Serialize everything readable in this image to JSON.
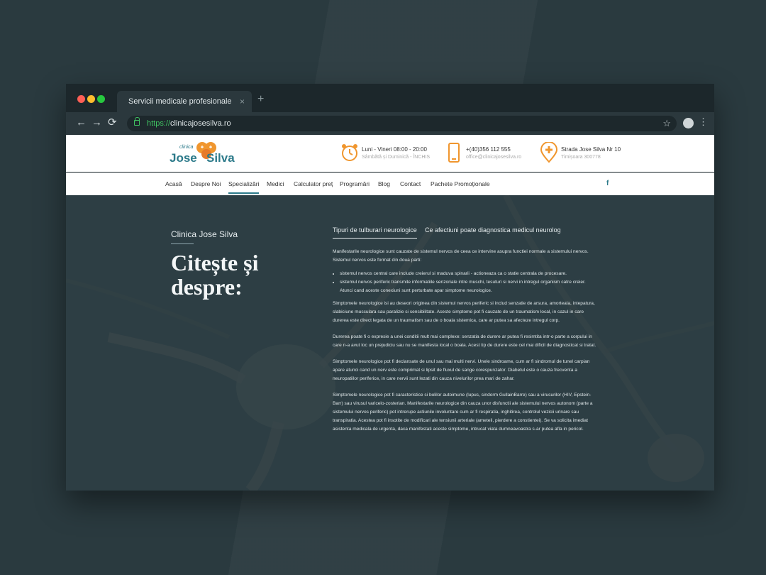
{
  "browser": {
    "tab_title": "Servicii medicale profesionale",
    "tab_close": "×",
    "new_tab": "+",
    "url_scheme": "https://",
    "url_host": "clinicajosesilva.ro",
    "back": "←",
    "forward": "→",
    "reload": "⟳",
    "star": "☆",
    "menu": "⋮"
  },
  "header": {
    "logo": {
      "small": "clinica",
      "word1": "Jose",
      "word2": "Silva"
    },
    "schedule": {
      "main": "Luni - Vineri 08:00 - 20:00",
      "sub": "Sâmbătă și Duminică - ÎNCHIS"
    },
    "contact": {
      "main": "+(40)356 112 555",
      "sub": "office@clinicajosesilva.ro"
    },
    "address": {
      "main": "Strada Jose Silva Nr 10",
      "sub": "Timișoara 300778"
    }
  },
  "nav": {
    "items": [
      "Acasă",
      "Despre Noi",
      "Specializări",
      "Medici",
      "Calculator preț",
      "Programări",
      "Blog",
      "Contact",
      "Pachete Promoționale"
    ],
    "active": "Specializări",
    "social": "f"
  },
  "hero": {
    "kicker": "Clinica Jose Silva",
    "title": "Citește și despre:",
    "tabs": [
      "Tipuri de tulburari neurologice",
      "Ce afectiuni poate diagnostica medicul neurolog"
    ],
    "intro": "Manifestarile neurologice sunt cauzate de sistemul nervos de ceea ce intervine asupra functiei normale a sistemului nervos. Sistemul nervos este format din doua parti:",
    "bullets": [
      "sistemul nervos central care include creierul si maduva spinarii - actioneaza ca o statie centrala de procesare.",
      "sistemul nervos periferic transmite informatiile senzoriale intre muschi, tesuturi si nervi in intregul organism catre creier. Atunci cand aceste conexiuni sunt perturbate apar simptome neurologice."
    ],
    "paragraphs": [
      "Simptomele neurologice isi au deseori originea din sistemul nervos periferic si includ senzatie de arsura, amorteala, intepatura, slabiciune musculara sau paralizie si sensibilitate. Aceste simptome pot fi cauzate de un traumatism local, in cazul in care durerea este direct legata de un traumatism sau de o boala sistemica, care ar putea sa afecteze intregul corp.",
      "Durerea poate fi o expresie a unei conditii mult mai complexe: senzatia de durere ar putea fi resimtita intr-o parte a corpului in care n-a avut loc un prejudiciu sau nu se manifesta local o boala. Acest tip de durere este cel mai dificil de diagnosticat si tratat.",
      "Simptomele neurologice pot fi declansate de unul sau mai multi nervi. Unele sindroame, cum ar fi sindromul de tunel carpian apare atunci cand un nerv este comprimat si lipsit de fluxul de sange corespunzator. Diabetul este o cauza frecventa a neuropatiilor periferice, in care nervii sunt lezati din cauza nivelurilor prea mari de zahar.",
      "Simptomele neurologice pot fi caracteristice si bolilor autoimune (lupus, sindorm GullainBarre) sau a virusurilor (HIV, Epstein-Barr) sau virusul varicelo-zosterian. Manifestarile neurologice din cauza unor disfunctii ale sistemului nervos autonom (parte a sistemului nervos periferic) pot intrerupe actiunile involuntare cum ar fi respiratia, inghitirea, controlul vezicii urinare sau transpiratia. Acestea pot fi insotite de modificari ale tensiunii arteriale (ameteli, pierdere a constientei). Se va solicita imediat asistenta medicala de urgenta, daca manifestati aceste simptome, intrucat viata dumneavoastra s-ar putea afla in pericol."
    ]
  },
  "colors": {
    "accent": "#2c7a8a",
    "orange": "#f0962e",
    "backdrop": "#2a3a3f"
  }
}
